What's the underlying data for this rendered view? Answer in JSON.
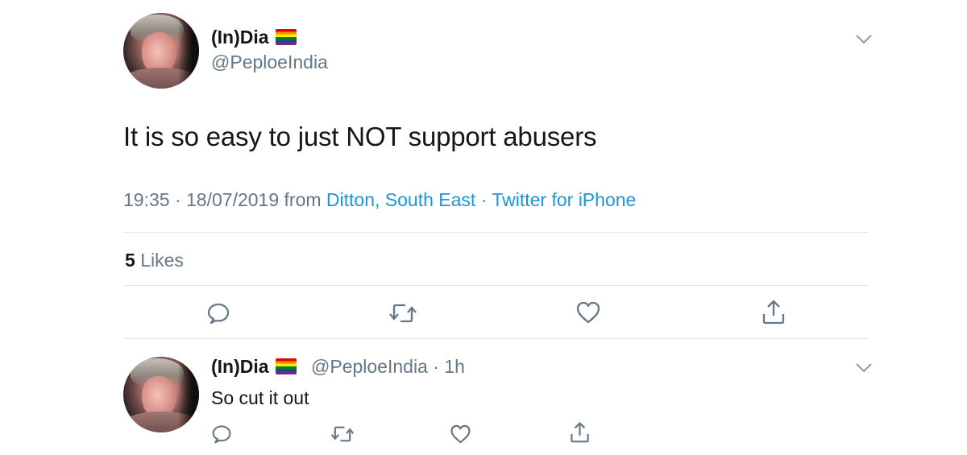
{
  "main_tweet": {
    "display_name": "(In)Dia",
    "handle": "@PeploeIndia",
    "text": "It is so easy to just NOT support abusers",
    "time": "19:35",
    "date": "18/07/2019",
    "from_label": "from",
    "location": "Ditton, South East",
    "client": "Twitter for iPhone",
    "likes_count": "5",
    "likes_label": "Likes"
  },
  "reply_tweet": {
    "display_name": "(In)Dia",
    "handle": "@PeploeIndia",
    "age": "1h",
    "text": "So cut it out"
  },
  "icons": {
    "reply": "reply-icon",
    "retweet": "retweet-icon",
    "like": "heart-icon",
    "share": "share-icon",
    "menu": "chevron-down-icon",
    "flag": "rainbow-flag-icon"
  },
  "colors": {
    "text": "#14171a",
    "secondary": "#657786",
    "link": "#1b95e0",
    "divider": "#e1e8ed"
  }
}
